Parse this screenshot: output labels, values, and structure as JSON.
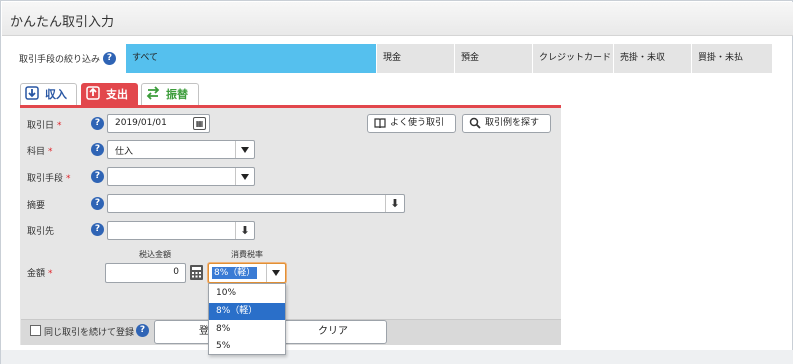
{
  "app": {
    "title": "かんたん取引入力"
  },
  "filter": {
    "label": "取引手段の絞り込み",
    "segments": [
      "すべて",
      "現金",
      "預金",
      "クレジットカード",
      "売掛・未収",
      "買掛・未払"
    ],
    "active_index": 0
  },
  "tabs": [
    {
      "label": "収入",
      "icon": "income-arrow-icon"
    },
    {
      "label": "支出",
      "icon": "expense-arrow-icon",
      "active": true
    },
    {
      "label": "振替",
      "icon": "transfer-arrows-icon"
    }
  ],
  "form": {
    "date": {
      "label": "取引日",
      "value": "2019/01/01"
    },
    "account": {
      "label": "科目",
      "value": "仕入"
    },
    "method": {
      "label": "取引手段",
      "value": ""
    },
    "memo": {
      "label": "摘要",
      "value": ""
    },
    "partner": {
      "label": "取引先",
      "value": ""
    },
    "amount": {
      "label": "金額",
      "col_amount": "税込金額",
      "col_tax": "消費税率",
      "value": "0",
      "tax_value": "8%（軽）"
    },
    "required_mark": "*",
    "help_glyph": "?"
  },
  "buttons": {
    "frequent": "よく使う取引",
    "search_examples": "取引例を探す",
    "register": "登",
    "clear": "クリア"
  },
  "tax_options": [
    {
      "label": "10%"
    },
    {
      "label": "8%（軽）",
      "selected": true
    },
    {
      "label": "8%"
    },
    {
      "label": "5%"
    }
  ],
  "footer": {
    "continue_label": "同じ取引を続けて登録"
  },
  "colors": {
    "accent_red": "#e2474c",
    "active_segment": "#55c0ee",
    "help_blue": "#2f64b5",
    "selected_option": "#2a6fc9"
  }
}
